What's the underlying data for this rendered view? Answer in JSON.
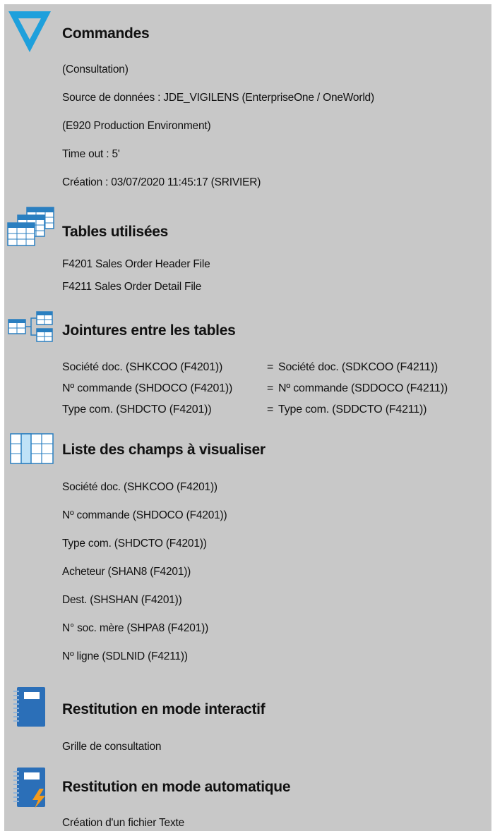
{
  "sections": {
    "commandes": {
      "title": "Commandes",
      "lines": [
        "(Consultation)",
        "Source de données : JDE_VIGILENS   (EnterpriseOne / OneWorld)",
        "(E920 Production Environment)",
        "Time out : 5'",
        "Création :  03/07/2020 11:45:17 (SRIVIER)"
      ]
    },
    "tables": {
      "title": "Tables utilisées",
      "lines": [
        "F4201  Sales Order Header File",
        "F4211  Sales Order Detail File"
      ]
    },
    "jointures": {
      "title": "Jointures entre les tables",
      "rows": [
        {
          "left": "Société doc. (SHKCOO (F4201))",
          "eq": "=",
          "right": "Société doc. (SDKCOO (F4211))"
        },
        {
          "left": "Nº commande (SHDOCO (F4201))",
          "eq": "=",
          "right": "Nº commande (SDDOCO (F4211))"
        },
        {
          "left": "Type com. (SHDCTO (F4201))",
          "eq": "=",
          "right": "Type com. (SDDCTO (F4211))"
        }
      ]
    },
    "champs": {
      "title": "Liste des champs à visualiser",
      "lines": [
        "Société doc. (SHKCOO (F4201))",
        "Nº commande (SHDOCO (F4201))",
        "Type com. (SHDCTO (F4201))",
        "Acheteur (SHAN8 (F4201))",
        "Dest. (SHSHAN (F4201))",
        "N° soc. mère (SHPA8 (F4201))",
        "Nº ligne (SDLNID (F4211))"
      ]
    },
    "interactif": {
      "title": "Restitution en mode interactif",
      "lines": [
        "Grille de consultation"
      ]
    },
    "automatique": {
      "title": "Restitution en mode automatique",
      "lines": [
        "Création d'un fichier Texte"
      ]
    }
  },
  "icons": {
    "logo": "vigilens-v-logo-icon",
    "tables": "stacked-tables-icon",
    "joins": "table-join-icon",
    "fields": "field-columns-icon",
    "interactive": "notebook-icon",
    "automatic": "notebook-lightning-icon"
  },
  "colors": {
    "panel": "#c8c8c8",
    "logo_blue": "#1ea0dc",
    "table_blue": "#2a7fc0",
    "notebook_blue": "#2b6fb8",
    "lightning_orange": "#f39a1c"
  }
}
